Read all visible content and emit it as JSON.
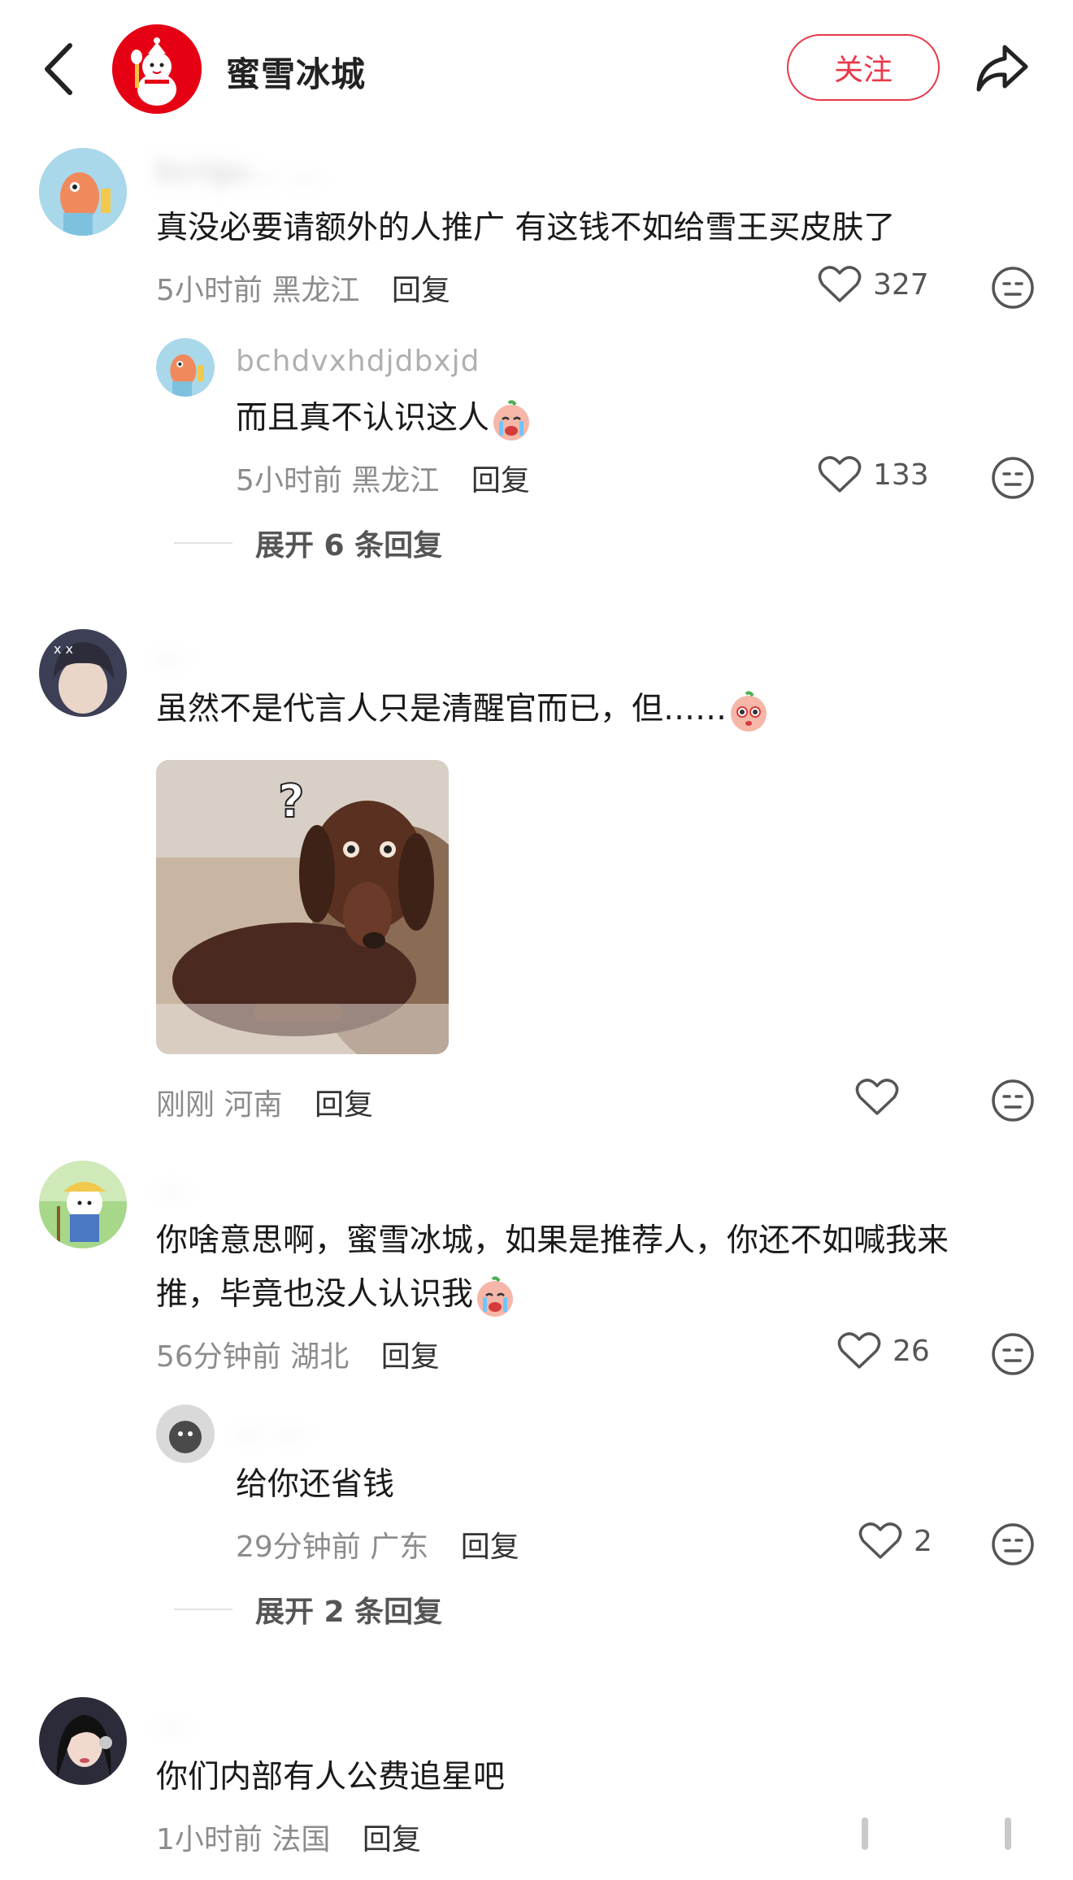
{
  "header": {
    "brand_name": "蜜雪冰城",
    "follow_label": "关注"
  },
  "comments": [
    {
      "username": "bcngu... ...",
      "text": "真没必要请额外的人推广 有这钱不如给雪王买皮肤了",
      "time": "5小时前",
      "location": "黑龙江",
      "reply_label": "回复",
      "likes": "327",
      "replies": [
        {
          "username": "bchdvxhdjdbxjd",
          "text": "而且真不认识这人",
          "time": "5小时前",
          "location": "黑龙江",
          "reply_label": "回复",
          "likes": "133"
        }
      ],
      "expand_label": "展开 6 条回复"
    },
    {
      "username": "...",
      "text": "虽然不是代言人只是清醒官而已，但……",
      "time": "刚刚",
      "location": "河南",
      "reply_label": "回复",
      "likes": ""
    },
    {
      "username": "...",
      "text_line1": "你啥意思啊，蜜雪冰城，如果是推荐人，你还不如喊我来",
      "text_line2": "推，毕竟也没人认识我",
      "time": "56分钟前",
      "location": "湖北",
      "reply_label": "回复",
      "likes": "26",
      "replies": [
        {
          "username": "... ...",
          "text": "给你还省钱",
          "time": "29分钟前",
          "location": "广东",
          "reply_label": "回复",
          "likes": "2"
        }
      ],
      "expand_label": "展开 2 条回复"
    },
    {
      "username": "...",
      "text": "你们内部有人公费追星吧",
      "time": "1小时前",
      "location": "法国",
      "reply_label": "回复"
    }
  ],
  "icons": {
    "back": "chevron-left-icon",
    "share": "share-arrow-icon",
    "like": "heart-icon",
    "dislike": "neutral-face-icon"
  },
  "colors": {
    "brand_red": "#e60013",
    "follow_red": "#e8394a",
    "meta_gray": "#8c8c8c"
  }
}
